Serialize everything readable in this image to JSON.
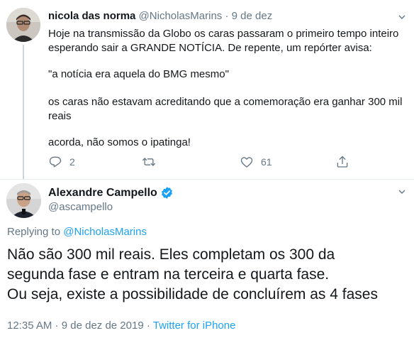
{
  "parent_tweet": {
    "display_name": "nicola das norma",
    "handle": "@NicholasMarins",
    "separator": "·",
    "date": "9 de dez",
    "paragraphs": [
      "Hoje na transmissão da Globo os caras passaram o primeiro tempo inteiro esperando sair a GRANDE NOTÍCIA. De repente, um repórter avisa:",
      "\"a notícia era aquela do BMG mesmo\"",
      "os caras não estavam acreditando que a comemoração era ganhar 300 mil reais",
      "acorda, não somos o ipatinga!"
    ],
    "actions": {
      "reply_count": "2",
      "retweet_count": "",
      "like_count": "61"
    }
  },
  "main_tweet": {
    "display_name": "Alexandre Campello",
    "verified": true,
    "handle": "@ascampello",
    "replying_prefix": "Replying to ",
    "replying_handle": "@NicholasMarins",
    "lines": [
      "Não são 300 mil reais. Eles completam os 300 da",
      "segunda fase e entram na terceira e quarta fase.",
      "Ou seja, existe a possibilidade de concluírem as 4 fases"
    ],
    "time": "12:35 AM",
    "footer_separator": " · ",
    "date": "9 de dez de 2019",
    "source": "Twitter for iPhone"
  },
  "colors": {
    "text": "#14171a",
    "secondary": "#657786",
    "link": "#1da1f2",
    "divider": "#e6ecf0",
    "verified": "#1da1f2"
  },
  "icons": [
    "chevron-down-icon",
    "reply-icon",
    "retweet-icon",
    "like-icon",
    "share-icon",
    "verified-badge-icon"
  ]
}
